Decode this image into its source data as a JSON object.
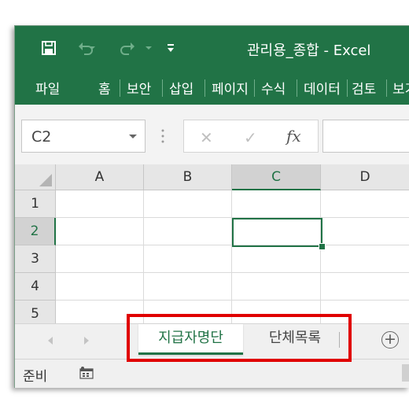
{
  "window": {
    "title": "관리용_종합  -  Excel"
  },
  "quick_access": {
    "save_icon": "save-icon",
    "undo_icon": "undo-icon",
    "redo_icon": "redo-icon",
    "customize_icon": "customize-qat-icon"
  },
  "ribbon": {
    "tabs": [
      {
        "label": "파일"
      },
      {
        "label": "홈"
      },
      {
        "label": "보안"
      },
      {
        "label": "삽입"
      },
      {
        "label": "페이지"
      },
      {
        "label": "수식"
      },
      {
        "label": "데이터"
      },
      {
        "label": "검토"
      },
      {
        "label": "보기"
      }
    ]
  },
  "formula_bar": {
    "name_box": "C2",
    "cancel_symbol": "✕",
    "enter_symbol": "✓",
    "insert_function_symbol": "fx",
    "value": ""
  },
  "grid": {
    "columns": [
      "A",
      "B",
      "C",
      "D"
    ],
    "rows": [
      "1",
      "2",
      "3",
      "4",
      "5"
    ],
    "selected_column": "C",
    "selected_row": "2"
  },
  "sheets": {
    "tabs": [
      {
        "label": "지급자명단",
        "active": true
      },
      {
        "label": "단체목록",
        "active": false
      }
    ],
    "add_symbol": "+"
  },
  "status": {
    "text": "준비"
  },
  "colors": {
    "excel_green": "#217346",
    "highlight_red": "#e00000"
  }
}
